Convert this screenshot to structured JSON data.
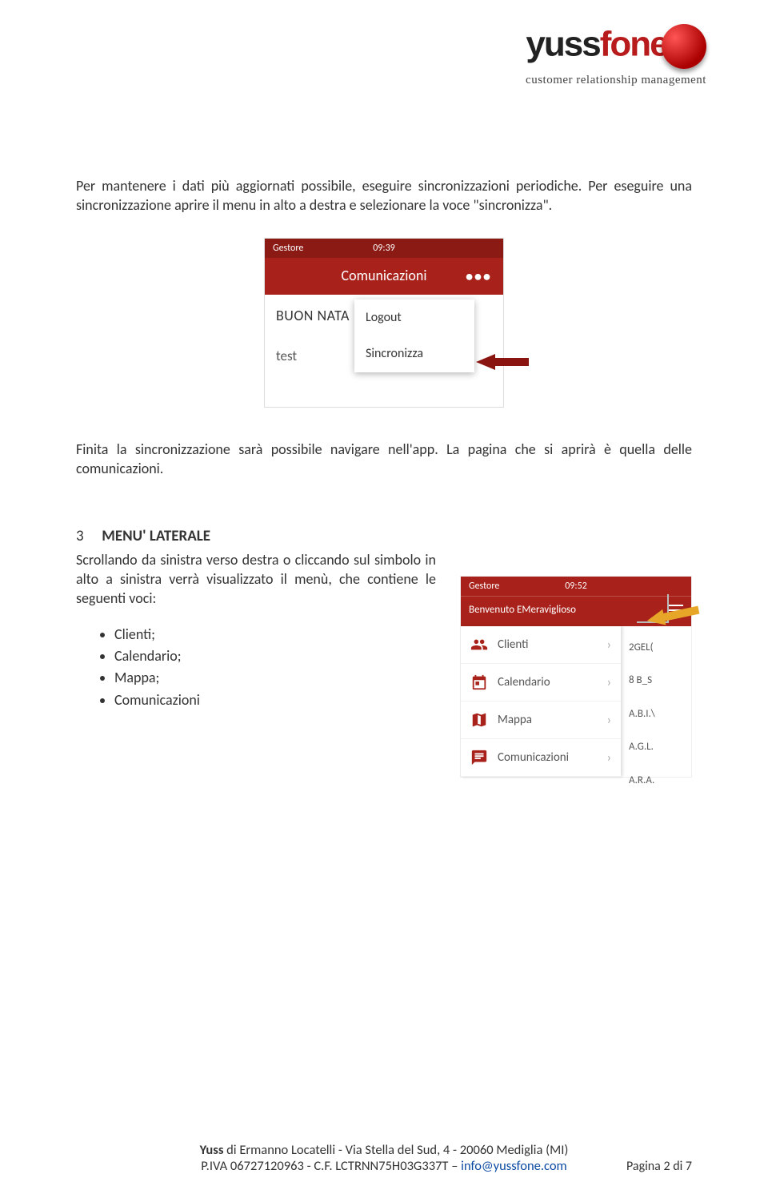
{
  "logo": {
    "brand_yuss": "yuss",
    "brand_fone": "fone",
    "tagline": "customer relationship management"
  },
  "para1": "Per mantenere i dati più aggiornati possibile, eseguire sincronizzazioni periodiche. Per eseguire una sincronizzazione aprire il menu in alto a destra e selezionare la voce \"sincronizza\".",
  "shot1": {
    "carrier": "Gestore",
    "time": "09:39",
    "title": "Comunicazioni",
    "line1": "BUON NATA",
    "line2": "test",
    "menu1": "Logout",
    "menu2": "Sincronizza"
  },
  "para2": "Finita la sincronizzazione sarà possibile navigare nell'app. La pagina che si aprirà è quella delle comunicazioni.",
  "section3": {
    "num": "3",
    "title": "MENU' LATERALE",
    "text": "Scrollando da sinistra verso destra o cliccando sul simbolo in alto a sinistra verrà visualizzato il menù, che contiene le seguenti voci:",
    "items": [
      "Clienti;",
      "Calendario;",
      "Mappa;",
      "Comunicazioni"
    ]
  },
  "shot2": {
    "carrier": "Gestore",
    "time": "09:52",
    "welcome": "Benvenuto EMeraviglioso",
    "drawer": [
      {
        "label": "Clienti"
      },
      {
        "label": "Calendario"
      },
      {
        "label": "Mappa"
      },
      {
        "label": "Comunicazioni"
      }
    ],
    "rightlist": [
      "2GEL(",
      "8 B_S",
      "A.B.I.\\",
      "A.G.L.",
      "A.R.A."
    ]
  },
  "footer": {
    "line1_a": "Yuss",
    "line1_b": " di Ermanno Locatelli - Via Stella del Sud, 4 - 20060 Mediglia (MI)",
    "line2_a": "P.IVA 06727120963 - C.F. LCTRNN75H03G337T – ",
    "email": "info@yussfone.com"
  },
  "pagenum": "Pagina 2 di 7"
}
